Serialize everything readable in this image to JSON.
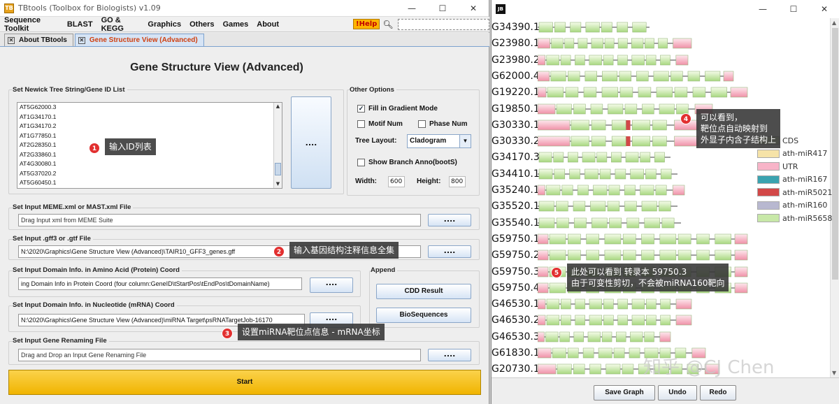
{
  "left_window": {
    "title": "TBtools (Toolbox for Biologists) v1.09",
    "icon_label": "TB",
    "menu": [
      "Sequence Toolkit",
      "BLAST",
      "GO & KEGG",
      "Graphics",
      "Others",
      "Games",
      "About"
    ],
    "help_label": "!Help",
    "tabs": [
      {
        "label": "About TBtools"
      },
      {
        "label": "Gene Structure View (Advanced)"
      }
    ],
    "page_title": "Gene Structure View (Advanced)",
    "newick": {
      "label": "Set Newick Tree String/Gene ID List",
      "ids": [
        "AT5G62000.3",
        "AT1G34170.1",
        "AT1G34170.2",
        "AT1G77850.1",
        "AT2G28350.1",
        "AT2G33860.1",
        "AT4G30080.1",
        "AT5G37020.2",
        "AT5G60450.1"
      ],
      "button": "...."
    },
    "other_options": {
      "label": "Other Options",
      "fill_gradient": "Fill in Gradient Mode",
      "motif_num": "Motif Num",
      "phase_num": "Phase Num",
      "tree_layout_label": "Tree Layout:",
      "tree_layout_value": "Cladogram",
      "show_branch": "Show Branch Anno(bootS)",
      "width_label": "Width:",
      "width_value": "600",
      "height_label": "Height:",
      "height_value": "800"
    },
    "meme": {
      "label": "Set Input MEME.xml or MAST.xml File",
      "placeholder": "Drag Input xml from MEME Suite",
      "button": "...."
    },
    "gff": {
      "label": "Set Input .gff3 or .gtf File",
      "value": "N:\\2020\\Graphics\\Gene Structure View (Advanced)\\TAIR10_GFF3_genes.gff",
      "button": "...."
    },
    "domain_aa": {
      "label": "Set Input Domain Info. in Amino Acid (Protein) Coord",
      "value": "ing Domain Info in Protein Coord (four column:GeneID\\tStartPos\\tEndPos\\tDomainName)",
      "button": "...."
    },
    "append": {
      "label": "Append",
      "cdd": "CDD Result",
      "bioseq": "BioSequences"
    },
    "domain_nt": {
      "label": "Set Input Domain Info. in Nucleotide (mRNA) Coord",
      "value": "N:\\2020\\Graphics\\Gene Structure View (Advanced)\\miRNA Target\\psRNATargetJob-16170",
      "button": "...."
    },
    "renaming": {
      "label": "Set Input Gene Renaming File",
      "placeholder": "Drag and Drop an Input Gene Renaming File",
      "button": "...."
    },
    "start_label": "Start"
  },
  "callouts": [
    {
      "num": "1",
      "text": "输入ID列表"
    },
    {
      "num": "2",
      "text": "输入基因结构注释信息全集"
    },
    {
      "num": "3",
      "text": "设置miRNA靶位点信息 - mRNA坐标"
    },
    {
      "num": "4",
      "lines": [
        "可以看到，",
        "靶位点自动映射到",
        "外显子内含子结构上"
      ]
    },
    {
      "num": "5",
      "lines": [
        "此处可以看到 转录本 59750.3",
        "由于可变性剪切，不会被miRNA160靶向"
      ]
    }
  ],
  "right_window": {
    "icon_label": "JB",
    "genes": [
      {
        "label": "G34390.1",
        "len": 160,
        "utr5": 0,
        "utr3": 0,
        "exons": 7,
        "site": -1
      },
      {
        "label": "G23980.1",
        "len": 220,
        "utr5": 0.08,
        "utr3": 0.12,
        "exons": 9,
        "site": -1
      },
      {
        "label": "G23980.2",
        "len": 215,
        "utr5": 0.05,
        "utr3": 0.08,
        "exons": 9,
        "site": -1
      },
      {
        "label": "G62000.4",
        "len": 280,
        "utr5": 0.06,
        "utr3": 0.05,
        "exons": 10,
        "site": -1
      },
      {
        "label": "G19220.1",
        "len": 300,
        "utr5": 0.04,
        "utr3": 0.08,
        "exons": 10,
        "site": -1
      },
      {
        "label": "G19850.1",
        "len": 250,
        "utr5": 0.1,
        "utr3": 0.1,
        "exons": 8,
        "site": -1
      },
      {
        "label": "G30330.1",
        "len": 230,
        "utr5": 0.2,
        "utr3": 0.15,
        "exons": 5,
        "site": 0.55
      },
      {
        "label": "G30330.2",
        "len": 230,
        "utr5": 0.2,
        "utr3": 0.15,
        "exons": 5,
        "site": 0.55
      },
      {
        "label": "G34170.3",
        "len": 190,
        "utr5": 0,
        "utr3": 0,
        "exons": 9,
        "site": -1
      },
      {
        "label": "G34410.1",
        "len": 200,
        "utr5": 0,
        "utr3": 0,
        "exons": 9,
        "site": -1
      },
      {
        "label": "G35240.1",
        "len": 210,
        "utr5": 0.05,
        "utr3": 0.08,
        "exons": 8,
        "site": -1
      },
      {
        "label": "G35520.1",
        "len": 200,
        "utr5": 0,
        "utr3": 0,
        "exons": 8,
        "site": -1
      },
      {
        "label": "G35540.1",
        "len": 205,
        "utr5": 0,
        "utr3": 0,
        "exons": 8,
        "site": -1
      },
      {
        "label": "G59750.1",
        "len": 300,
        "utr5": 0.05,
        "utr3": 0.06,
        "exons": 10,
        "site": -1
      },
      {
        "label": "G59750.2",
        "len": 300,
        "utr5": 0.05,
        "utr3": 0.06,
        "exons": 10,
        "site": -1
      },
      {
        "label": "G59750.3",
        "len": 300,
        "utr5": 0.05,
        "utr3": 0.06,
        "exons": 10,
        "site": -1
      },
      {
        "label": "G59750.4",
        "len": 300,
        "utr5": 0.05,
        "utr3": 0.06,
        "exons": 10,
        "site": -1
      },
      {
        "label": "G46530.1",
        "len": 220,
        "utr5": 0.05,
        "utr3": 0.1,
        "exons": 9,
        "site": -1
      },
      {
        "label": "G46530.2",
        "len": 220,
        "utr5": 0.05,
        "utr3": 0.1,
        "exons": 9,
        "site": -1
      },
      {
        "label": "G46530.3",
        "len": 190,
        "utr5": 0.05,
        "utr3": 0.08,
        "exons": 8,
        "site": -1
      },
      {
        "label": "G61830.1",
        "len": 240,
        "utr5": 0.08,
        "utr3": 0.08,
        "exons": 9,
        "site": -1
      },
      {
        "label": "G20730.1",
        "len": 260,
        "utr5": 0.1,
        "utr3": 0.08,
        "exons": 9,
        "site": -1
      }
    ],
    "legend": [
      {
        "label": "CDS",
        "color": "#d9efbf"
      },
      {
        "label": "ath-miR417",
        "color": "#f6e3a8"
      },
      {
        "label": "UTR",
        "color": "#f8b4c8"
      },
      {
        "label": "ath-miR167",
        "color": "#3aa3b0"
      },
      {
        "label": "ath-miR5021",
        "color": "#d24848"
      },
      {
        "label": "ath-miR160",
        "color": "#b8b8d0"
      },
      {
        "label": "ath-miR5658",
        "color": "#c8e8a8"
      }
    ],
    "buttons": {
      "save": "Save Graph",
      "undo": "Undo",
      "redo": "Redo"
    }
  },
  "watermark": "知乎 @CJ Chen",
  "colors": {
    "cds_light": "#f5fbe9",
    "cds_dark": "#a8d880",
    "utr_light": "#fde8ee",
    "utr_dark": "#f090a8",
    "site": "#d24848",
    "accent": "#f0b400"
  }
}
